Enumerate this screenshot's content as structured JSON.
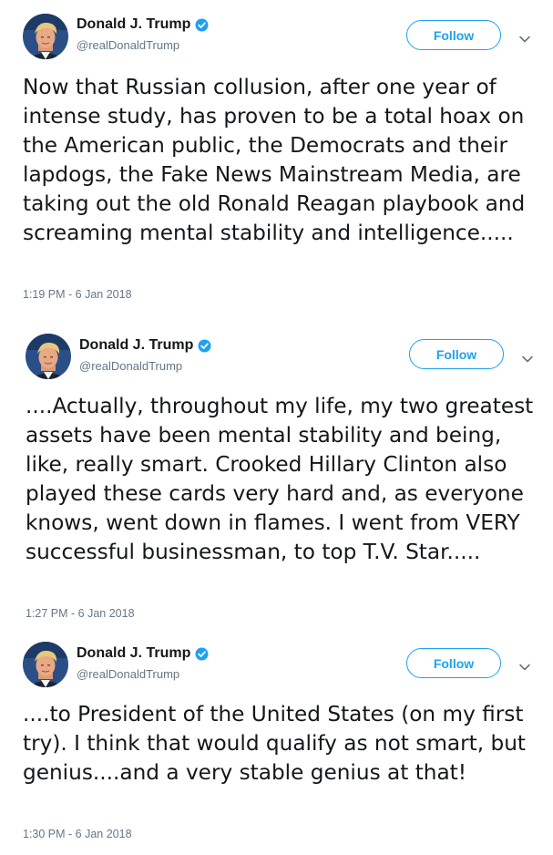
{
  "colors": {
    "accent": "#1da1f2",
    "verified_badge": "#1da1f2",
    "secondary_text": "#657786",
    "primary_text": "#14171a"
  },
  "tweets": [
    {
      "author": {
        "name": "Donald J. Trump",
        "handle": "@realDonaldTrump",
        "verified": true
      },
      "follow_label": "Follow",
      "menu_icon": "chevron-down-icon",
      "text": "Now that Russian collusion, after one year of intense study, has proven to be a total hoax on the American public, the Democrats and their lapdogs, the Fake News Mainstream Media, are taking out the old Ronald Reagan playbook and screaming mental stability and intelligence.....",
      "timestamp": "1:19 PM - 6 Jan 2018"
    },
    {
      "author": {
        "name": "Donald J. Trump",
        "handle": "@realDonaldTrump",
        "verified": true
      },
      "follow_label": "Follow",
      "menu_icon": "chevron-down-icon",
      "text": "....Actually, throughout my life, my two greatest assets have been mental stability and being, like, really smart. Crooked Hillary Clinton also played these cards very hard and, as everyone knows, went down in flames. I went from VERY successful businessman, to top T.V. Star.....",
      "timestamp": "1:27 PM - 6 Jan 2018"
    },
    {
      "author": {
        "name": "Donald J. Trump",
        "handle": "@realDonaldTrump",
        "verified": true
      },
      "follow_label": "Follow",
      "menu_icon": "chevron-down-icon",
      "text": "....to President of the United States (on my first try). I think that would qualify as not smart, but genius....and a very stable genius at that!",
      "timestamp": "1:30 PM - 6 Jan 2018"
    }
  ]
}
